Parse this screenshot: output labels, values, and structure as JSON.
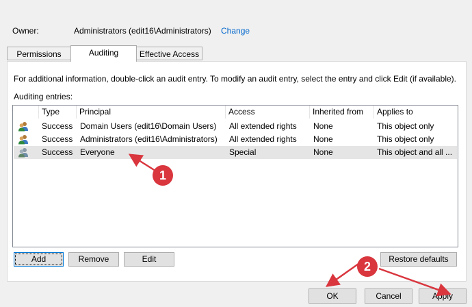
{
  "owner": {
    "label": "Owner:",
    "value": "Administrators (edit16\\Administrators)",
    "change_link": "Change"
  },
  "tabs": [
    {
      "label": "Permissions",
      "active": false
    },
    {
      "label": "Auditing",
      "active": true
    },
    {
      "label": "Effective Access",
      "active": false
    }
  ],
  "info_text": "For additional information, double-click an audit entry. To modify an audit entry, select the entry and click Edit (if available).",
  "entries_label": "Auditing entries:",
  "table": {
    "columns": [
      "Type",
      "Principal",
      "Access",
      "Inherited from",
      "Applies to"
    ],
    "rows": [
      {
        "icon": "user-group-icon",
        "type": "Success",
        "principal": "Domain Users (edit16\\Domain Users)",
        "access": "All extended rights",
        "inherited": "None",
        "applies": "This object only",
        "selected": false
      },
      {
        "icon": "user-group-icon",
        "type": "Success",
        "principal": "Administrators (edit16\\Administrators)",
        "access": "All extended rights",
        "inherited": "None",
        "applies": "This object only",
        "selected": false
      },
      {
        "icon": "user-group-icon",
        "type": "Success",
        "principal": "Everyone",
        "access": "Special",
        "inherited": "None",
        "applies": "This object and all ...",
        "selected": true
      }
    ]
  },
  "buttons": {
    "add": "Add",
    "remove": "Remove",
    "edit": "Edit",
    "restore": "Restore defaults",
    "ok": "OK",
    "cancel": "Cancel",
    "apply": "Apply"
  },
  "annotations": {
    "badge1": "1",
    "badge2": "2",
    "color": "#d9363e"
  }
}
